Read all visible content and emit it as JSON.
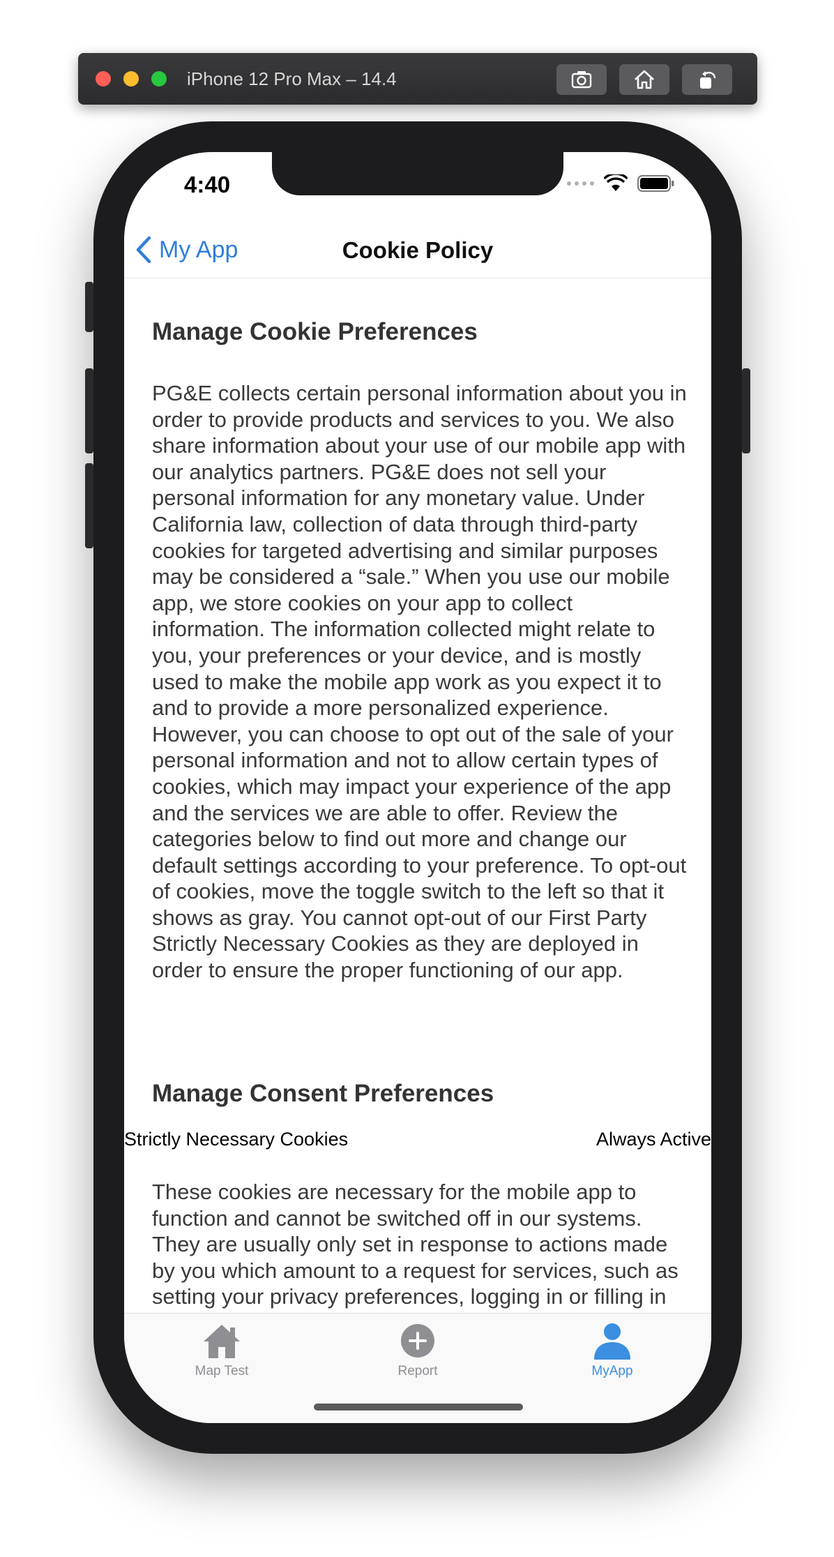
{
  "simulator": {
    "title": "iPhone 12 Pro Max – 14.4",
    "buttons": [
      "screenshot-icon",
      "home-icon",
      "rotate-icon"
    ]
  },
  "status_bar": {
    "time": "4:40",
    "icons": [
      "signal-dots-icon",
      "wifi-icon",
      "battery-icon"
    ]
  },
  "nav": {
    "back_label": "My App",
    "title": "Cookie Policy"
  },
  "content": {
    "heading1": "Manage Cookie Preferences",
    "paragraph1": "PG&E collects certain personal information about you in order to provide products and services to you. We also share information about your use of our mobile app with our analytics partners. PG&E does not sell your personal information for any monetary value. Under California law, collection of data through third-party cookies for targeted advertising and similar purposes may be considered a “sale.” When you use our mobile app, we store cookies on your app to collect information. The information collected might relate to you, your preferences or your device, and is mostly used to make the mobile app work as you expect it to and to provide a more personalized experience. However, you can choose to opt out of the sale of your personal information and not to allow certain types of cookies, which may impact your experience of the app and the services we are able to offer. Review the categories below to find out more and change our default settings according to your preference. To opt-out of cookies, move the toggle switch to the left so that it shows as gray. You cannot opt-out of our First Party Strictly Necessary Cookies as they are deployed in order to ensure the proper functioning of our app.",
    "heading2": "Manage Consent Preferences",
    "row_label": "Strictly Necessary Cookies",
    "row_status": "Always Active",
    "paragraph2": "These cookies are necessary for the mobile app to function and cannot be switched off in our systems. They are usually only set in response to actions made by you which amount to a request for services, such as setting your privacy preferences, logging in or filling in forms. These cookies do not store any"
  },
  "tabbar": {
    "items": [
      {
        "label": "Map Test",
        "icon": "house-icon",
        "active": false
      },
      {
        "label": "Report",
        "icon": "plus-circle-icon",
        "active": false
      },
      {
        "label": "MyApp",
        "icon": "person-icon",
        "active": true
      }
    ],
    "active_color": "#3b8ee0",
    "inactive_color": "#8e8e93"
  },
  "colors": {
    "link_blue": "#2f7fd8",
    "phone_frame": "#1c1c1e"
  }
}
